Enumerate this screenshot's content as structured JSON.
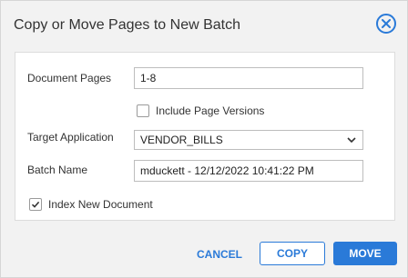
{
  "dialog": {
    "title": "Copy or Move Pages to New Batch"
  },
  "form": {
    "document_pages_label": "Document Pages",
    "document_pages_value": "1-8",
    "include_versions_label": "Include Page Versions",
    "include_versions_checked": false,
    "target_app_label": "Target Application",
    "target_app_value": "VENDOR_BILLS",
    "batch_name_label": "Batch Name",
    "batch_name_value": "mduckett - 12/12/2022 10:41:22 PM",
    "index_new_doc_label": "Index New Document",
    "index_new_doc_checked": true
  },
  "footer": {
    "cancel_label": "CANCEL",
    "copy_label": "COPY",
    "move_label": "MOVE"
  },
  "colors": {
    "accent": "#2a7ad8",
    "background": "#f2f2f2"
  },
  "icons": {
    "close": "close-circle-icon",
    "dropdown": "chevron-down-icon",
    "check": "check-icon"
  }
}
